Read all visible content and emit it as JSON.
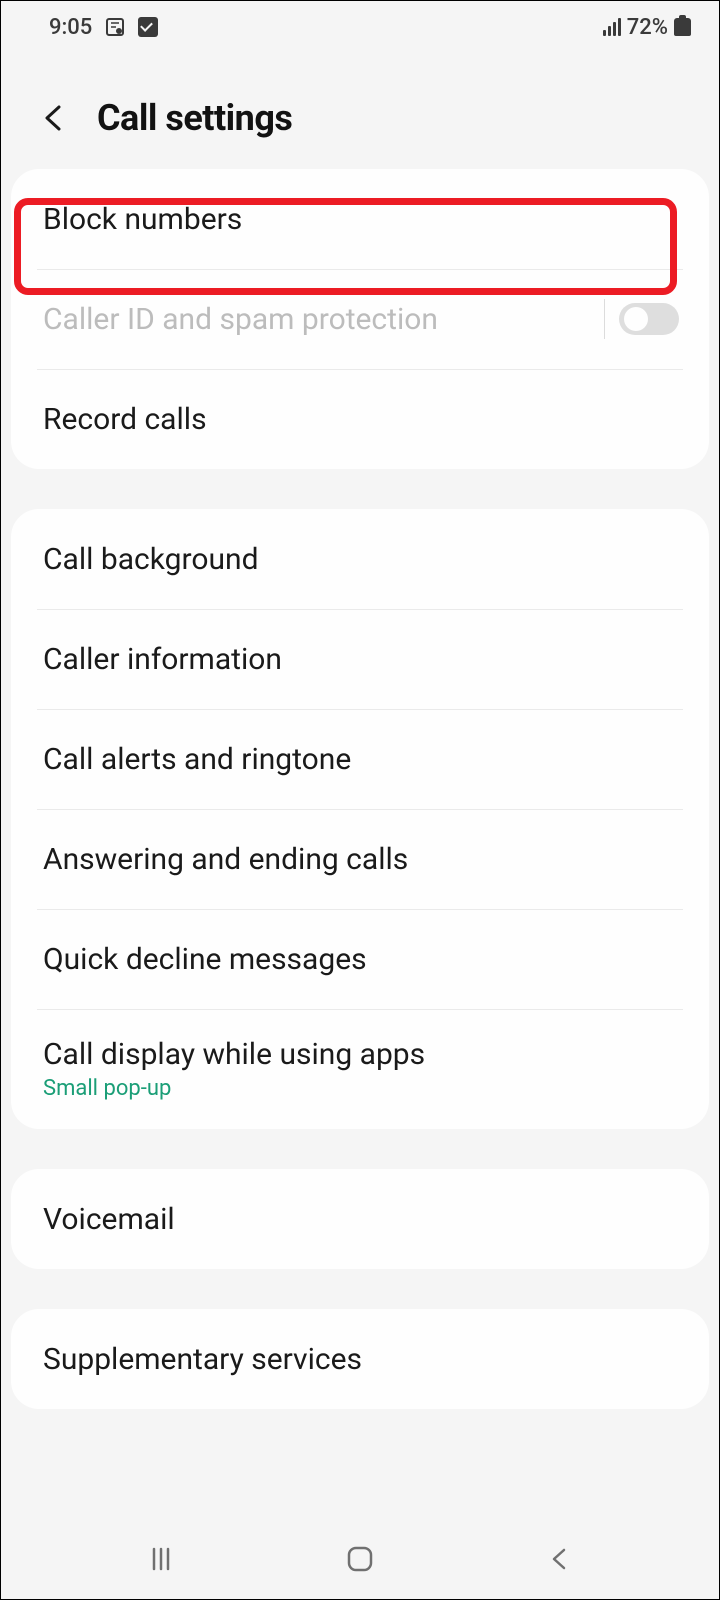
{
  "status": {
    "time": "9:05",
    "battery_pct": "72%"
  },
  "header": {
    "title": "Call settings"
  },
  "sections": [
    {
      "items": [
        {
          "label": "Block numbers",
          "highlighted": true
        },
        {
          "label": "Caller ID and spam protection",
          "disabled": true,
          "toggle": false
        },
        {
          "label": "Record calls"
        }
      ]
    },
    {
      "items": [
        {
          "label": "Call background"
        },
        {
          "label": "Caller information"
        },
        {
          "label": "Call alerts and ringtone"
        },
        {
          "label": "Answering and ending calls"
        },
        {
          "label": "Quick decline messages"
        },
        {
          "label": "Call display while using apps",
          "sub": "Small pop-up"
        }
      ]
    },
    {
      "items": [
        {
          "label": "Voicemail"
        }
      ]
    },
    {
      "items": [
        {
          "label": "Supplementary services"
        }
      ]
    }
  ]
}
